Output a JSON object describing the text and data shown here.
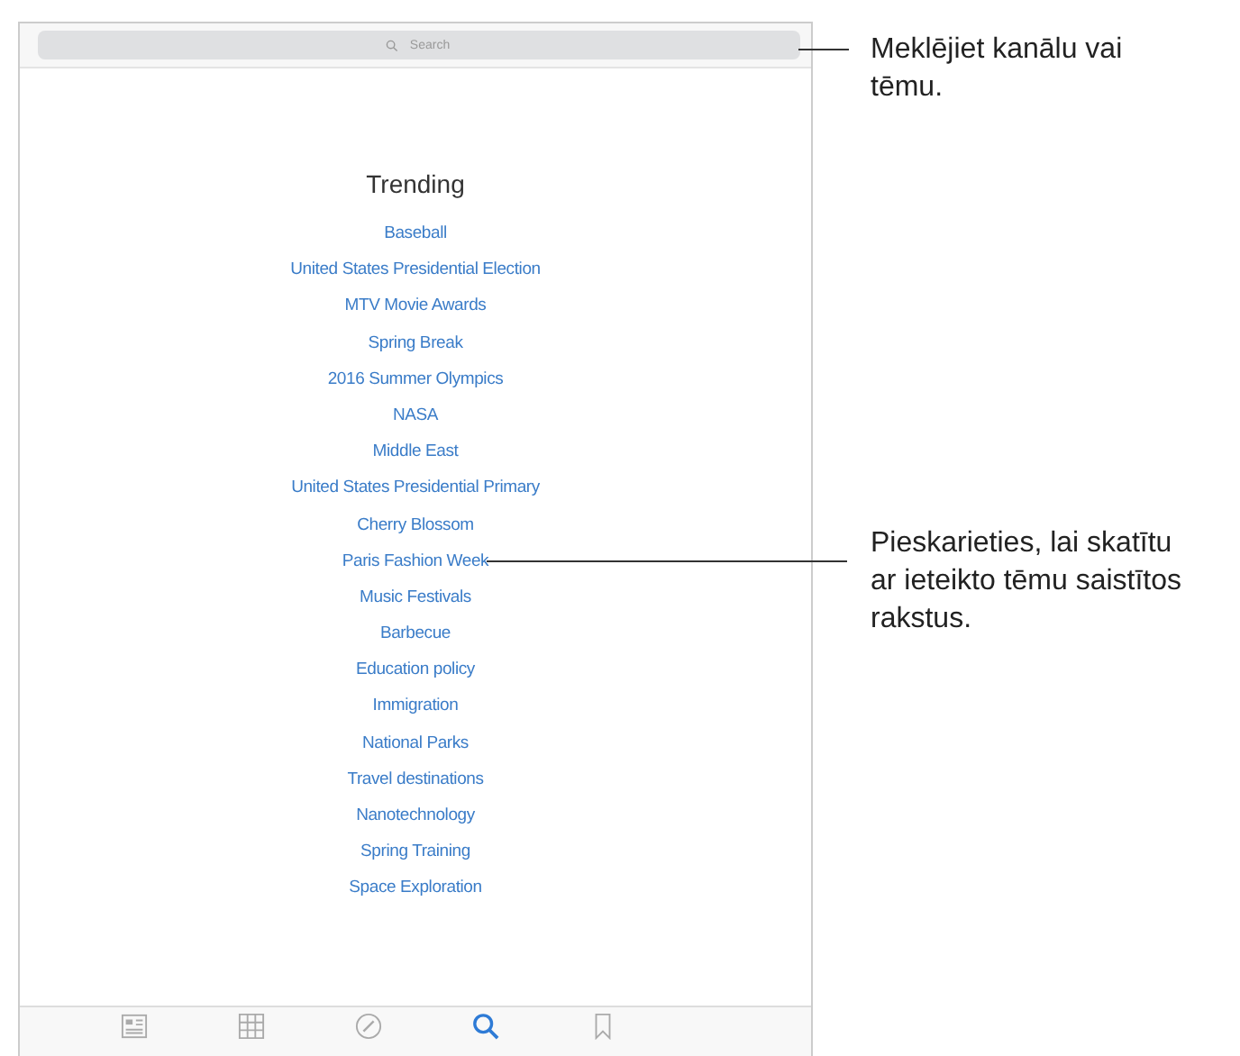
{
  "search": {
    "placeholder": "Search"
  },
  "trending": {
    "title": "Trending",
    "items": [
      "Baseball",
      "United States Presidential Election",
      "MTV Movie Awards",
      "Spring Break",
      "2016 Summer Olympics",
      "NASA",
      "Middle East",
      "United States Presidential Primary",
      "Cherry Blossom",
      "Paris Fashion Week",
      "Music Festivals",
      "Barbecue",
      "Education policy",
      "Immigration",
      "National Parks",
      "Travel destinations",
      "Nanotechnology",
      "Spring Training",
      "Space Exploration"
    ]
  },
  "tab_bar": [
    {
      "kind": "news",
      "selected": false
    },
    {
      "kind": "grid",
      "selected": false
    },
    {
      "kind": "compass",
      "selected": false
    },
    {
      "kind": "search",
      "selected": true
    },
    {
      "kind": "bookmark",
      "selected": false
    }
  ],
  "callouts": [
    {
      "text": "Meklējiet kanālu vai tēmu."
    },
    {
      "text": "Pieskarieties, lai skatītu ar ieteikto tēmu saistītos rakstus."
    }
  ]
}
